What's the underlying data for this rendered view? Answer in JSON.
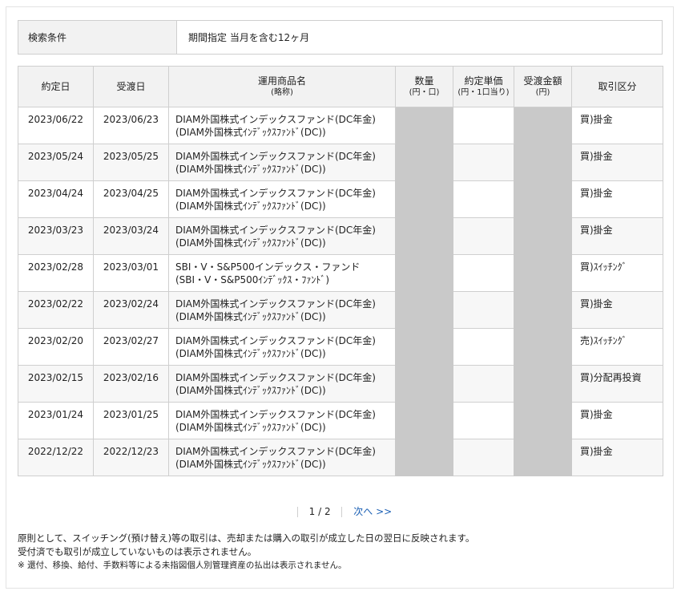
{
  "search": {
    "label": "検索条件",
    "value": "期間指定  当月を含む12ヶ月"
  },
  "table": {
    "headers": {
      "trade_date": "約定日",
      "delivery_date": "受渡日",
      "fund_name": "運用商品名",
      "fund_name_sub": "(略称)",
      "quantity": "数量",
      "quantity_sub": "(円・口)",
      "unit_price": "約定単価",
      "unit_price_sub": "(円・1口当り)",
      "amount": "受渡金額",
      "amount_sub": "(円)",
      "category": "取引区分"
    },
    "rows": [
      {
        "trade_date": "2023/06/22",
        "delivery_date": "2023/06/23",
        "name": "DIAM外国株式インデックスファンド(DC年金)",
        "short": "(DIAM外国株式ｲﾝﾃﾞｯｸｽﾌｧﾝﾄﾞ(DC))",
        "category": "買)掛金"
      },
      {
        "trade_date": "2023/05/24",
        "delivery_date": "2023/05/25",
        "name": "DIAM外国株式インデックスファンド(DC年金)",
        "short": "(DIAM外国株式ｲﾝﾃﾞｯｸｽﾌｧﾝﾄﾞ(DC))",
        "category": "買)掛金"
      },
      {
        "trade_date": "2023/04/24",
        "delivery_date": "2023/04/25",
        "name": "DIAM外国株式インデックスファンド(DC年金)",
        "short": "(DIAM外国株式ｲﾝﾃﾞｯｸｽﾌｧﾝﾄﾞ(DC))",
        "category": "買)掛金"
      },
      {
        "trade_date": "2023/03/23",
        "delivery_date": "2023/03/24",
        "name": "DIAM外国株式インデックスファンド(DC年金)",
        "short": "(DIAM外国株式ｲﾝﾃﾞｯｸｽﾌｧﾝﾄﾞ(DC))",
        "category": "買)掛金"
      },
      {
        "trade_date": "2023/02/28",
        "delivery_date": "2023/03/01",
        "name": "SBI・V・S&P500インデックス・ファンド",
        "short": "(SBI・V・S&P500ｲﾝﾃﾞｯｸｽ・ﾌｧﾝﾄﾞ)",
        "category": "買)ｽｲｯﾁﾝｸﾞ"
      },
      {
        "trade_date": "2023/02/22",
        "delivery_date": "2023/02/24",
        "name": "DIAM外国株式インデックスファンド(DC年金)",
        "short": "(DIAM外国株式ｲﾝﾃﾞｯｸｽﾌｧﾝﾄﾞ(DC))",
        "category": "買)掛金"
      },
      {
        "trade_date": "2023/02/20",
        "delivery_date": "2023/02/27",
        "name": "DIAM外国株式インデックスファンド(DC年金)",
        "short": "(DIAM外国株式ｲﾝﾃﾞｯｸｽﾌｧﾝﾄﾞ(DC))",
        "category": "売)ｽｲｯﾁﾝｸﾞ"
      },
      {
        "trade_date": "2023/02/15",
        "delivery_date": "2023/02/16",
        "name": "DIAM外国株式インデックスファンド(DC年金)",
        "short": "(DIAM外国株式ｲﾝﾃﾞｯｸｽﾌｧﾝﾄﾞ(DC))",
        "category": "買)分配再投資"
      },
      {
        "trade_date": "2023/01/24",
        "delivery_date": "2023/01/25",
        "name": "DIAM外国株式インデックスファンド(DC年金)",
        "short": "(DIAM外国株式ｲﾝﾃﾞｯｸｽﾌｧﾝﾄﾞ(DC))",
        "category": "買)掛金"
      },
      {
        "trade_date": "2022/12/22",
        "delivery_date": "2022/12/23",
        "name": "DIAM外国株式インデックスファンド(DC年金)",
        "short": "(DIAM外国株式ｲﾝﾃﾞｯｸｽﾌｧﾝﾄﾞ(DC))",
        "category": "買)掛金"
      }
    ]
  },
  "pagination": {
    "current": "1 / 2",
    "next_label": "次へ >>"
  },
  "notes": {
    "line1": "原則として、スイッチング(預け替え)等の取引は、売却または購入の取引が成立した日の翌日に反映されます。",
    "line2": "受付済でも取引が成立していないものは表示されません。",
    "line3": "※  還付、移換、給付、手数料等による未指図個人別管理資産の払出は表示されません。"
  },
  "colors": {
    "header_bg": "#f2f2f2",
    "alt_row_bg": "#f7f7f7",
    "redaction": "#c9c9c9",
    "link": "#1a5fb4"
  }
}
